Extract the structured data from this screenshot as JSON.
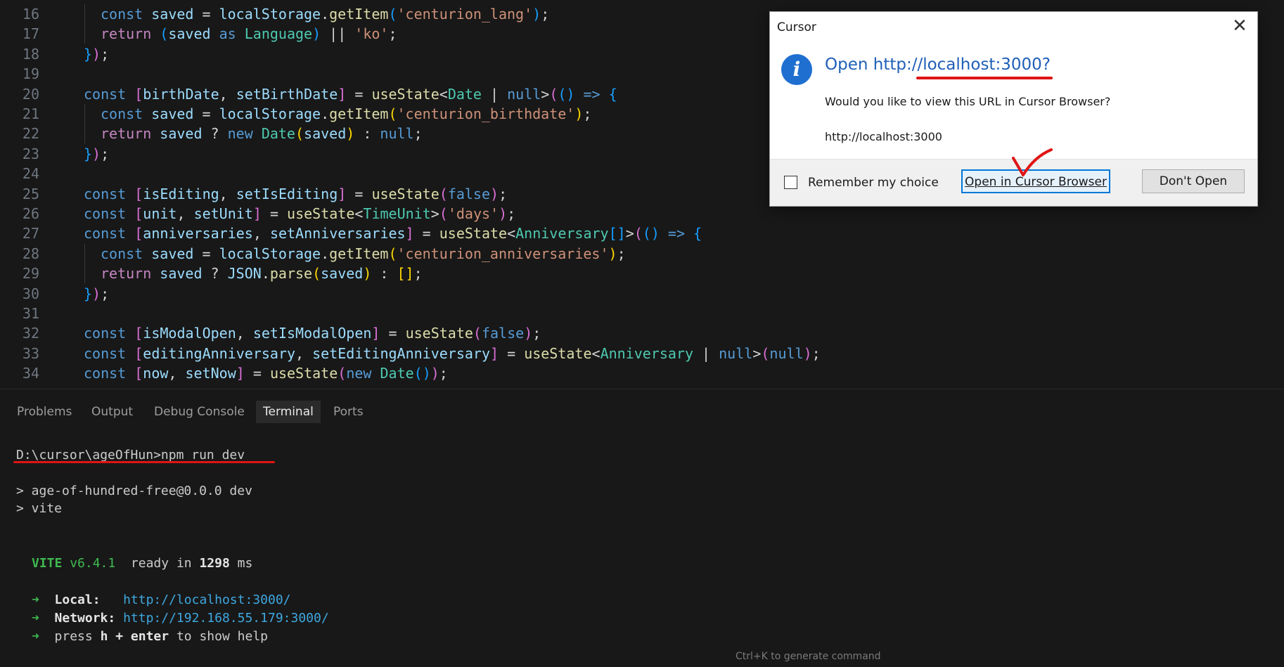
{
  "editor": {
    "lines": [
      {
        "n": "16",
        "indent": 1,
        "tokens": [
          [
            "k",
            "const "
          ],
          [
            "v",
            "saved"
          ],
          [
            "p",
            " = "
          ],
          [
            "v",
            "localStorage"
          ],
          [
            "p",
            "."
          ],
          [
            "f",
            "getItem"
          ],
          [
            "b2",
            "("
          ],
          [
            "s",
            "'centurion_lang'"
          ],
          [
            "b2",
            ")"
          ],
          [
            "p",
            ";"
          ]
        ]
      },
      {
        "n": "17",
        "indent": 1,
        "tokens": [
          [
            "c",
            "return "
          ],
          [
            "b2",
            "("
          ],
          [
            "v",
            "saved"
          ],
          [
            "k",
            " as "
          ],
          [
            "t",
            "Language"
          ],
          [
            "b2",
            ")"
          ],
          [
            "p",
            " || "
          ],
          [
            "s",
            "'ko'"
          ],
          [
            "p",
            ";"
          ]
        ]
      },
      {
        "n": "18",
        "indent": 0,
        "tokens": [
          [
            "b2",
            "}"
          ],
          [
            "b1",
            ")"
          ],
          [
            "p",
            ";"
          ]
        ]
      },
      {
        "n": "19",
        "indent": 0,
        "tokens": []
      },
      {
        "n": "20",
        "indent": 0,
        "tokens": [
          [
            "k",
            "const "
          ],
          [
            "b1",
            "["
          ],
          [
            "v",
            "birthDate"
          ],
          [
            "p",
            ", "
          ],
          [
            "v",
            "setBirthDate"
          ],
          [
            "b1",
            "]"
          ],
          [
            "p",
            " = "
          ],
          [
            "f",
            "useState"
          ],
          [
            "p",
            "<"
          ],
          [
            "t",
            "Date"
          ],
          [
            "p",
            " | "
          ],
          [
            "n",
            "null"
          ],
          [
            "p",
            ">"
          ],
          [
            "b1",
            "("
          ],
          [
            "b2",
            "()"
          ],
          [
            "k",
            " => "
          ],
          [
            "b2",
            "{"
          ]
        ]
      },
      {
        "n": "21",
        "indent": 1,
        "tokens": [
          [
            "k",
            "const "
          ],
          [
            "v",
            "saved"
          ],
          [
            "p",
            " = "
          ],
          [
            "v",
            "localStorage"
          ],
          [
            "p",
            "."
          ],
          [
            "f",
            "getItem"
          ],
          [
            "b3",
            "("
          ],
          [
            "s",
            "'centurion_birthdate'"
          ],
          [
            "b3",
            ")"
          ],
          [
            "p",
            ";"
          ]
        ]
      },
      {
        "n": "22",
        "indent": 1,
        "tokens": [
          [
            "c",
            "return "
          ],
          [
            "v",
            "saved"
          ],
          [
            "p",
            " ? "
          ],
          [
            "k",
            "new "
          ],
          [
            "t",
            "Date"
          ],
          [
            "b3",
            "("
          ],
          [
            "v",
            "saved"
          ],
          [
            "b3",
            ")"
          ],
          [
            "p",
            " : "
          ],
          [
            "n",
            "null"
          ],
          [
            "p",
            ";"
          ]
        ]
      },
      {
        "n": "23",
        "indent": 0,
        "tokens": [
          [
            "b2",
            "}"
          ],
          [
            "b1",
            ")"
          ],
          [
            "p",
            ";"
          ]
        ]
      },
      {
        "n": "24",
        "indent": 0,
        "tokens": []
      },
      {
        "n": "25",
        "indent": 0,
        "tokens": [
          [
            "k",
            "const "
          ],
          [
            "b1",
            "["
          ],
          [
            "v",
            "isEditing"
          ],
          [
            "p",
            ", "
          ],
          [
            "v",
            "setIsEditing"
          ],
          [
            "b1",
            "]"
          ],
          [
            "p",
            " = "
          ],
          [
            "f",
            "useState"
          ],
          [
            "b1",
            "("
          ],
          [
            "n",
            "false"
          ],
          [
            "b1",
            ")"
          ],
          [
            "p",
            ";"
          ]
        ]
      },
      {
        "n": "26",
        "indent": 0,
        "tokens": [
          [
            "k",
            "const "
          ],
          [
            "b1",
            "["
          ],
          [
            "v",
            "unit"
          ],
          [
            "p",
            ", "
          ],
          [
            "v",
            "setUnit"
          ],
          [
            "b1",
            "]"
          ],
          [
            "p",
            " = "
          ],
          [
            "f",
            "useState"
          ],
          [
            "p",
            "<"
          ],
          [
            "t",
            "TimeUnit"
          ],
          [
            "p",
            ">"
          ],
          [
            "b1",
            "("
          ],
          [
            "s",
            "'days'"
          ],
          [
            "b1",
            ")"
          ],
          [
            "p",
            ";"
          ]
        ]
      },
      {
        "n": "27",
        "indent": 0,
        "tokens": [
          [
            "k",
            "const "
          ],
          [
            "b1",
            "["
          ],
          [
            "v",
            "anniversaries"
          ],
          [
            "p",
            ", "
          ],
          [
            "v",
            "setAnniversaries"
          ],
          [
            "b1",
            "]"
          ],
          [
            "p",
            " = "
          ],
          [
            "f",
            "useState"
          ],
          [
            "p",
            "<"
          ],
          [
            "t",
            "Anniversary"
          ],
          [
            "b2",
            "[]"
          ],
          [
            "p",
            ">"
          ],
          [
            "b1",
            "("
          ],
          [
            "b2",
            "()"
          ],
          [
            "k",
            " => "
          ],
          [
            "b2",
            "{"
          ]
        ]
      },
      {
        "n": "28",
        "indent": 1,
        "tokens": [
          [
            "k",
            "const "
          ],
          [
            "v",
            "saved"
          ],
          [
            "p",
            " = "
          ],
          [
            "v",
            "localStorage"
          ],
          [
            "p",
            "."
          ],
          [
            "f",
            "getItem"
          ],
          [
            "b3",
            "("
          ],
          [
            "s",
            "'centurion_anniversaries'"
          ],
          [
            "b3",
            ")"
          ],
          [
            "p",
            ";"
          ]
        ]
      },
      {
        "n": "29",
        "indent": 1,
        "tokens": [
          [
            "c",
            "return "
          ],
          [
            "v",
            "saved"
          ],
          [
            "p",
            " ? "
          ],
          [
            "v",
            "JSON"
          ],
          [
            "p",
            "."
          ],
          [
            "f",
            "parse"
          ],
          [
            "b3",
            "("
          ],
          [
            "v",
            "saved"
          ],
          [
            "b3",
            ")"
          ],
          [
            "p",
            " : "
          ],
          [
            "b3",
            "[]"
          ],
          [
            "p",
            ";"
          ]
        ]
      },
      {
        "n": "30",
        "indent": 0,
        "tokens": [
          [
            "b2",
            "}"
          ],
          [
            "b1",
            ")"
          ],
          [
            "p",
            ";"
          ]
        ]
      },
      {
        "n": "31",
        "indent": 0,
        "tokens": []
      },
      {
        "n": "32",
        "indent": 0,
        "tokens": [
          [
            "k",
            "const "
          ],
          [
            "b1",
            "["
          ],
          [
            "v",
            "isModalOpen"
          ],
          [
            "p",
            ", "
          ],
          [
            "v",
            "setIsModalOpen"
          ],
          [
            "b1",
            "]"
          ],
          [
            "p",
            " = "
          ],
          [
            "f",
            "useState"
          ],
          [
            "b1",
            "("
          ],
          [
            "n",
            "false"
          ],
          [
            "b1",
            ")"
          ],
          [
            "p",
            ";"
          ]
        ]
      },
      {
        "n": "33",
        "indent": 0,
        "tokens": [
          [
            "k",
            "const "
          ],
          [
            "b1",
            "["
          ],
          [
            "v",
            "editingAnniversary"
          ],
          [
            "p",
            ", "
          ],
          [
            "v",
            "setEditingAnniversary"
          ],
          [
            "b1",
            "]"
          ],
          [
            "p",
            " = "
          ],
          [
            "f",
            "useState"
          ],
          [
            "p",
            "<"
          ],
          [
            "t",
            "Anniversary"
          ],
          [
            "p",
            " | "
          ],
          [
            "n",
            "null"
          ],
          [
            "p",
            ">"
          ],
          [
            "b1",
            "("
          ],
          [
            "n",
            "null"
          ],
          [
            "b1",
            ")"
          ],
          [
            "p",
            ";"
          ]
        ]
      },
      {
        "n": "34",
        "indent": 0,
        "tokens": [
          [
            "k",
            "const "
          ],
          [
            "b1",
            "["
          ],
          [
            "v",
            "now"
          ],
          [
            "p",
            ", "
          ],
          [
            "v",
            "setNow"
          ],
          [
            "b1",
            "]"
          ],
          [
            "p",
            " = "
          ],
          [
            "f",
            "useState"
          ],
          [
            "b1",
            "("
          ],
          [
            "k",
            "new "
          ],
          [
            "t",
            "Date"
          ],
          [
            "b2",
            "()"
          ],
          [
            "b1",
            ")"
          ],
          [
            "p",
            ";"
          ]
        ]
      }
    ]
  },
  "panel": {
    "tabs": [
      "Problems",
      "Output",
      "Debug Console",
      "Terminal",
      "Ports"
    ],
    "active_tab": "Terminal",
    "terminal": {
      "prompt": "D:\\cursor\\ageOfHun>npm run dev",
      "script_line": "> age-of-hundred-free@0.0.0 dev",
      "vite_line": "> vite",
      "vite_label": "VITE",
      "vite_version": "v6.4.1",
      "ready_text": "ready in",
      "ready_ms": "1298",
      "ms": "ms",
      "local_label": "Local:",
      "local_url": "http://localhost:3000/",
      "network_label": "Network:",
      "network_url": "http://192.168.55.179:3000/",
      "help_pre": "press",
      "help_h": "h + enter",
      "help_post": "to show help",
      "arrow": "➜"
    },
    "hint": "Ctrl+K to generate command"
  },
  "dialog": {
    "title": "Cursor",
    "heading": "Open http://localhost:3000?",
    "question": "Would you like to view this URL in Cursor Browser?",
    "url": "http://localhost:3000",
    "remember_label": "Remember my choice",
    "open_button": "Open in Cursor Browser",
    "dont_open_button": "Don't Open",
    "info_glyph": "i",
    "close_glyph": "✕"
  },
  "colors": {
    "annotation": "#e01515",
    "accent": "#0078d7"
  }
}
